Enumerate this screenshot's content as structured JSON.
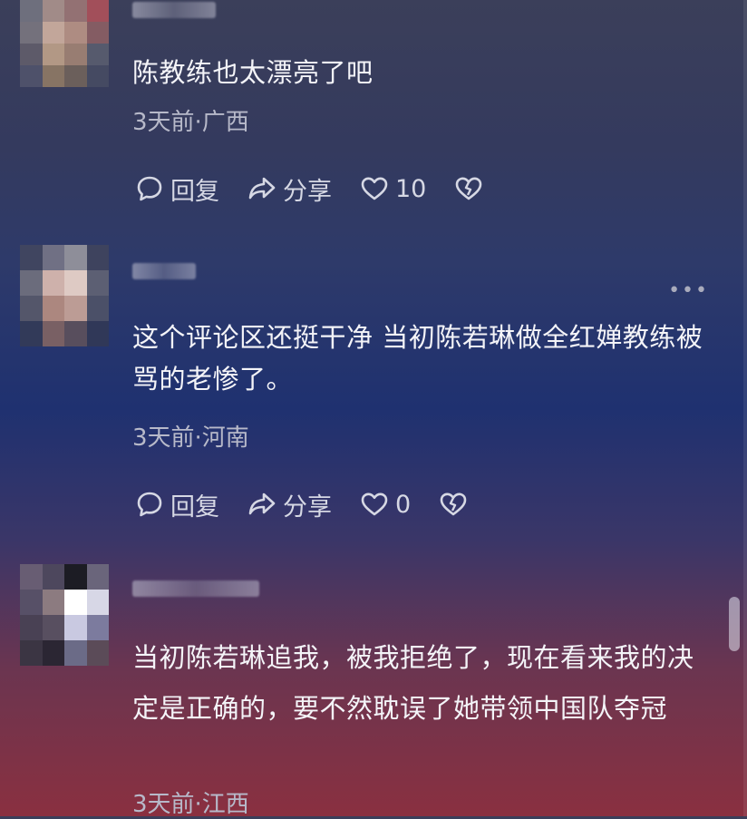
{
  "comments": [
    {
      "text": "陈教练也太漂亮了吧",
      "meta": "3天前·广西",
      "reply_label": "回复",
      "share_label": "分享",
      "like_count": "10"
    },
    {
      "text": "这个评论区还挺干净 当初陈若琳做全红婵教练被骂的老惨了。",
      "meta": "3天前·河南",
      "reply_label": "回复",
      "share_label": "分享",
      "like_count": "0",
      "more": "•••"
    },
    {
      "text": "当初陈若琳追我，被我拒绝了，现在看来我的决定是正确的，要不然耽误了她带领中国队夺冠",
      "meta": "3天前·江西"
    }
  ],
  "icons": {
    "reply": "comment-bubble-icon",
    "share": "share-arrow-icon",
    "like": "heart-icon",
    "dislike": "broken-heart-icon"
  },
  "colors": {
    "text": "#f4f4f8",
    "meta": "#b7b9c9",
    "action": "#d6d8e4"
  }
}
